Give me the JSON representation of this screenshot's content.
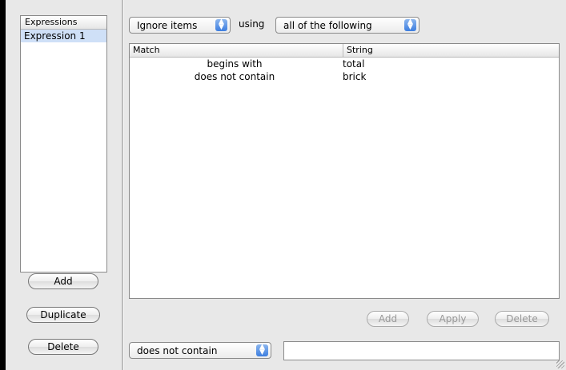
{
  "expressions": {
    "header": "Expressions",
    "items": [
      "Expression 1"
    ],
    "buttons": {
      "add": "Add",
      "duplicate": "Duplicate",
      "delete": "Delete"
    }
  },
  "rule": {
    "action_popup": "Ignore items",
    "using_label": "using",
    "mode_popup": "all of the following"
  },
  "table": {
    "headers": {
      "match": "Match",
      "string": "String"
    },
    "rows": [
      {
        "match": "begins with",
        "string": "total"
      },
      {
        "match": "does not contain",
        "string": "brick"
      }
    ]
  },
  "table_buttons": {
    "add": "Add",
    "apply": "Apply",
    "delete": "Delete"
  },
  "editor": {
    "condition_popup": "does not contain",
    "string_value": ""
  },
  "colors": {
    "selection": "#cfe0f7",
    "popup_arrow": "#3d7ee0"
  }
}
